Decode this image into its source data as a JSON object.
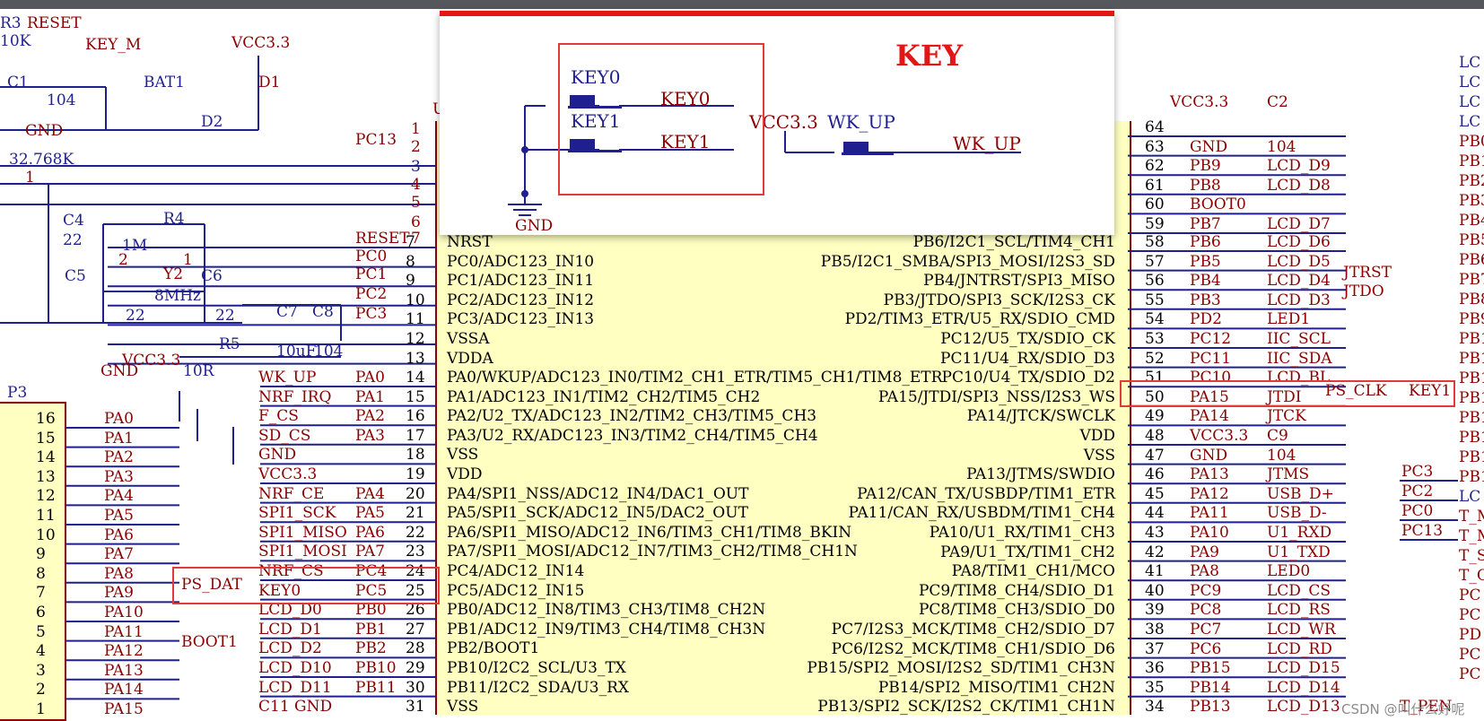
{
  "key_panel": {
    "title": "KEY",
    "labels": [
      "KEY0",
      "KEY0",
      "KEY1",
      "KEY1",
      "VCC3.3",
      "WK_UP",
      "WK_UP",
      "GND"
    ]
  },
  "left_top": [
    "R3",
    "RESET",
    "10K",
    "KEY_M",
    "VCC3.3",
    "D1",
    "C1",
    "104",
    "BAT1",
    "GND",
    "D2",
    "32.768K",
    "C4",
    "22",
    "R4",
    "1M",
    "Y2",
    "8MHz",
    "C5",
    "C6",
    "22",
    "22",
    "GND",
    "C7",
    "C8",
    "10uF",
    "104",
    "VCC3.3",
    "R5",
    "10R",
    "PC13",
    "RESET",
    "PC0",
    "PC1",
    "PC2",
    "PC3",
    "1",
    "2",
    "3",
    "4",
    "5",
    "6",
    "7",
    "2",
    "1",
    "1",
    "U"
  ],
  "chip_left_rows": [
    {
      "net": "WK_UP",
      "port": "PA0",
      "num": "14",
      "fn": "PA0/WKUP/ADC123_IN0/TIM2_CH1_ETR/TIM5_CH1/TIM8_ETR"
    },
    {
      "net": "NRF_IRQ",
      "port": "PA1",
      "num": "15",
      "fn": "PA1/ADC123_IN1/TIM2_CH2/TIM5_CH2"
    },
    {
      "net": "F_CS",
      "port": "PA2",
      "num": "16",
      "fn": "PA2/U2_TX/ADC123_IN2/TIM2_CH3/TIM5_CH3"
    },
    {
      "net": "SD_CS",
      "port": "PA3",
      "num": "17",
      "fn": "PA3/U2_RX/ADC123_IN3/TIM2_CH4/TIM5_CH4"
    },
    {
      "net": "GND",
      "port": "",
      "num": "18",
      "fn": "VSS"
    },
    {
      "net": "VCC3.3",
      "port": "",
      "num": "19",
      "fn": "VDD"
    },
    {
      "net": "NRF_CE",
      "port": "PA4",
      "num": "20",
      "fn": "PA4/SPI1_NSS/ADC12_IN4/DAC1_OUT"
    },
    {
      "net": "SPI1_SCK",
      "port": "PA5",
      "num": "21",
      "fn": "PA5/SPI1_SCK/ADC12_IN5/DAC2_OUT"
    },
    {
      "net": "SPI1_MISO",
      "port": "PA6",
      "num": "22",
      "fn": "PA6/SPI1_MISO/ADC12_IN6/TIM3_CH1/TIM8_BKIN"
    },
    {
      "net": "SPI1_MOSI",
      "port": "PA7",
      "num": "23",
      "fn": "PA7/SPI1_MOSI/ADC12_IN7/TIM3_CH2/TIM8_CH1N"
    },
    {
      "net": "NRF_CS",
      "port": "PC4",
      "num": "24",
      "fn": "PC4/ADC12_IN14"
    },
    {
      "net": "KEY0",
      "port": "PC5",
      "num": "25",
      "fn": "PC5/ADC12_IN15"
    },
    {
      "net": "LCD_D0",
      "port": "PB0",
      "num": "26",
      "fn": "PB0/ADC12_IN8/TIM3_CH3/TIM8_CH2N"
    },
    {
      "net": "LCD_D1",
      "port": "PB1",
      "num": "27",
      "fn": "PB1/ADC12_IN9/TIM3_CH4/TIM8_CH3N"
    },
    {
      "net": "LCD_D2",
      "port": "PB2",
      "num": "28",
      "fn": "PB2/BOOT1"
    },
    {
      "net": "LCD_D10",
      "port": "PB10",
      "num": "29",
      "fn": "PB10/I2C2_SCL/U3_TX"
    },
    {
      "net": "LCD_D11",
      "port": "PB11",
      "num": "30",
      "fn": "PB11/I2C2_SDA/U3_RX"
    },
    {
      "net": "C11 GND",
      "port": "",
      "num": "31",
      "fn": "VSS"
    }
  ],
  "chip_left_top": [
    {
      "num": "7",
      "fn": "NRST"
    },
    {
      "num": "8",
      "fn": "PC0/ADC123_IN10"
    },
    {
      "num": "9",
      "fn": "PC1/ADC123_IN11"
    },
    {
      "num": "10",
      "fn": "PC2/ADC123_IN12"
    },
    {
      "num": "11",
      "fn": "PC3/ADC123_IN13"
    },
    {
      "num": "12",
      "fn": "VSSA"
    },
    {
      "num": "13",
      "fn": "VDDA"
    }
  ],
  "chip_right_rows": [
    {
      "fn": "PB6/I2C1_SCL/TIM4_CH1",
      "num": "58",
      "port": "PB6",
      "net": "LCD_D6"
    },
    {
      "fn": "PB5/I2C1_SMBA/SPI3_MOSI/I2S3_SD",
      "num": "57",
      "port": "PB5",
      "net": "LCD_D5"
    },
    {
      "fn": "PB4/JNTRST/SPI3_MISO",
      "num": "56",
      "port": "PB4",
      "net": "LCD_D4"
    },
    {
      "fn": "PB3/JTDO/SPI3_SCK/I2S3_CK",
      "num": "55",
      "port": "PB3",
      "net": "LCD_D3"
    },
    {
      "fn": "PD2/TIM3_ETR/U5_RX/SDIO_CMD",
      "num": "54",
      "port": "PD2",
      "net": "LED1"
    },
    {
      "fn": "PC12/U5_TX/SDIO_CK",
      "num": "53",
      "port": "PC12",
      "net": "IIC_SCL"
    },
    {
      "fn": "PC11/U4_RX/SDIO_D3",
      "num": "52",
      "port": "PC11",
      "net": "IIC_SDA"
    },
    {
      "fn": "PC10/U4_TX/SDIO_D2",
      "num": "51",
      "port": "PC10",
      "net": "LCD_BL"
    },
    {
      "fn": "PA15/JTDI/SPI3_NSS/I2S3_WS",
      "num": "50",
      "port": "PA15",
      "net": "JTDI"
    },
    {
      "fn": "PA14/JTCK/SWCLK",
      "num": "49",
      "port": "PA14",
      "net": "JTCK"
    },
    {
      "fn": "VDD",
      "num": "48",
      "port": "VCC3.3",
      "net": "C9"
    },
    {
      "fn": "VSS",
      "num": "47",
      "port": "GND",
      "net": "104"
    },
    {
      "fn": "PA13/JTMS/SWDIO",
      "num": "46",
      "port": "PA13",
      "net": "JTMS"
    },
    {
      "fn": "PA12/CAN_TX/USBDP/TIM1_ETR",
      "num": "45",
      "port": "PA12",
      "net": "USB_D+"
    },
    {
      "fn": "PA11/CAN_RX/USBDM/TIM1_CH4",
      "num": "44",
      "port": "PA11",
      "net": "USB_D-"
    },
    {
      "fn": "PA10/U1_RX/TIM1_CH3",
      "num": "43",
      "port": "PA10",
      "net": "U1_RXD"
    },
    {
      "fn": "PA9/U1_TX/TIM1_CH2",
      "num": "42",
      "port": "PA9",
      "net": "U1_TXD"
    },
    {
      "fn": "PA8/TIM1_CH1/MCO",
      "num": "41",
      "port": "PA8",
      "net": "LED0"
    },
    {
      "fn": "PC9/TIM8_CH4/SDIO_D1",
      "num": "40",
      "port": "PC9",
      "net": "LCD_CS"
    },
    {
      "fn": "PC8/TIM8_CH3/SDIO_D0",
      "num": "39",
      "port": "PC8",
      "net": "LCD_RS"
    },
    {
      "fn": "PC7/I2S3_MCK/TIM8_CH2/SDIO_D7",
      "num": "38",
      "port": "PC7",
      "net": "LCD_WR"
    },
    {
      "fn": "PC6/I2S2_MCK/TIM8_CH1/SDIO_D6",
      "num": "37",
      "port": "PC6",
      "net": "LCD_RD"
    },
    {
      "fn": "PB15/SPI2_MOSI/I2S2_SD/TIM1_CH3N",
      "num": "36",
      "port": "PB15",
      "net": "LCD_D15"
    },
    {
      "fn": "PB14/SPI2_MISO/TIM1_CH2N",
      "num": "35",
      "port": "PB14",
      "net": "LCD_D14"
    },
    {
      "fn": "PB13/SPI2_SCK/I2S2_CK/TIM1_CH1N",
      "num": "34",
      "port": "PB13",
      "net": "LCD_D13"
    }
  ],
  "right_top": [
    {
      "num": "64",
      "port": "VCC3.3",
      "net": "C2"
    },
    {
      "num": "63",
      "port": "GND",
      "net": "104"
    },
    {
      "num": "62",
      "port": "PB9",
      "net": "LCD_D9"
    },
    {
      "num": "61",
      "port": "PB8",
      "net": "LCD_D8"
    },
    {
      "num": "60",
      "port": "BOOT0",
      "net": ""
    },
    {
      "num": "59",
      "port": "PB7",
      "net": "LCD_D7"
    }
  ],
  "right_extra": [
    "JTRST",
    "JTDO",
    "PS_CLK",
    "KEY1",
    "T_PEN"
  ],
  "p3": {
    "title": "P3",
    "rows": [
      {
        "n": "16",
        "net": "PA0"
      },
      {
        "n": "15",
        "net": "PA1"
      },
      {
        "n": "14",
        "net": "PA2"
      },
      {
        "n": "13",
        "net": "PA3"
      },
      {
        "n": "12",
        "net": "PA4"
      },
      {
        "n": "11",
        "net": "PA5"
      },
      {
        "n": "10",
        "net": "PA6"
      },
      {
        "n": "9",
        "net": "PA7"
      },
      {
        "n": "8",
        "net": "PA8"
      },
      {
        "n": "7",
        "net": "PA9"
      },
      {
        "n": "6",
        "net": "PA10"
      },
      {
        "n": "5",
        "net": "PA11"
      },
      {
        "n": "4",
        "net": "PA12"
      },
      {
        "n": "3",
        "net": "PA13"
      },
      {
        "n": "2",
        "net": "PA14"
      },
      {
        "n": "1",
        "net": "PA15"
      }
    ],
    "side_labels": [
      "PS_DAT",
      "BOOT1"
    ]
  },
  "far_right": [
    "LC",
    "LC",
    "LC",
    "LC",
    "PB0",
    "PB1",
    "PB2",
    "PB3",
    "PB4",
    "PB5",
    "PB6",
    "PB7",
    "PB8",
    "PB9",
    "PB1",
    "PB1",
    "PB1",
    "PB1",
    "PB1",
    "PB1",
    "PB1",
    "PB1",
    "LC",
    "T_M",
    "T_M",
    "T_S",
    "T_C",
    "PC",
    "PC",
    "PD",
    "PC",
    "PC"
  ],
  "far_right_mid": [
    "PC3",
    "PC2",
    "PC0",
    "PC13"
  ],
  "watermark": "CSDN @叫什么好呢"
}
